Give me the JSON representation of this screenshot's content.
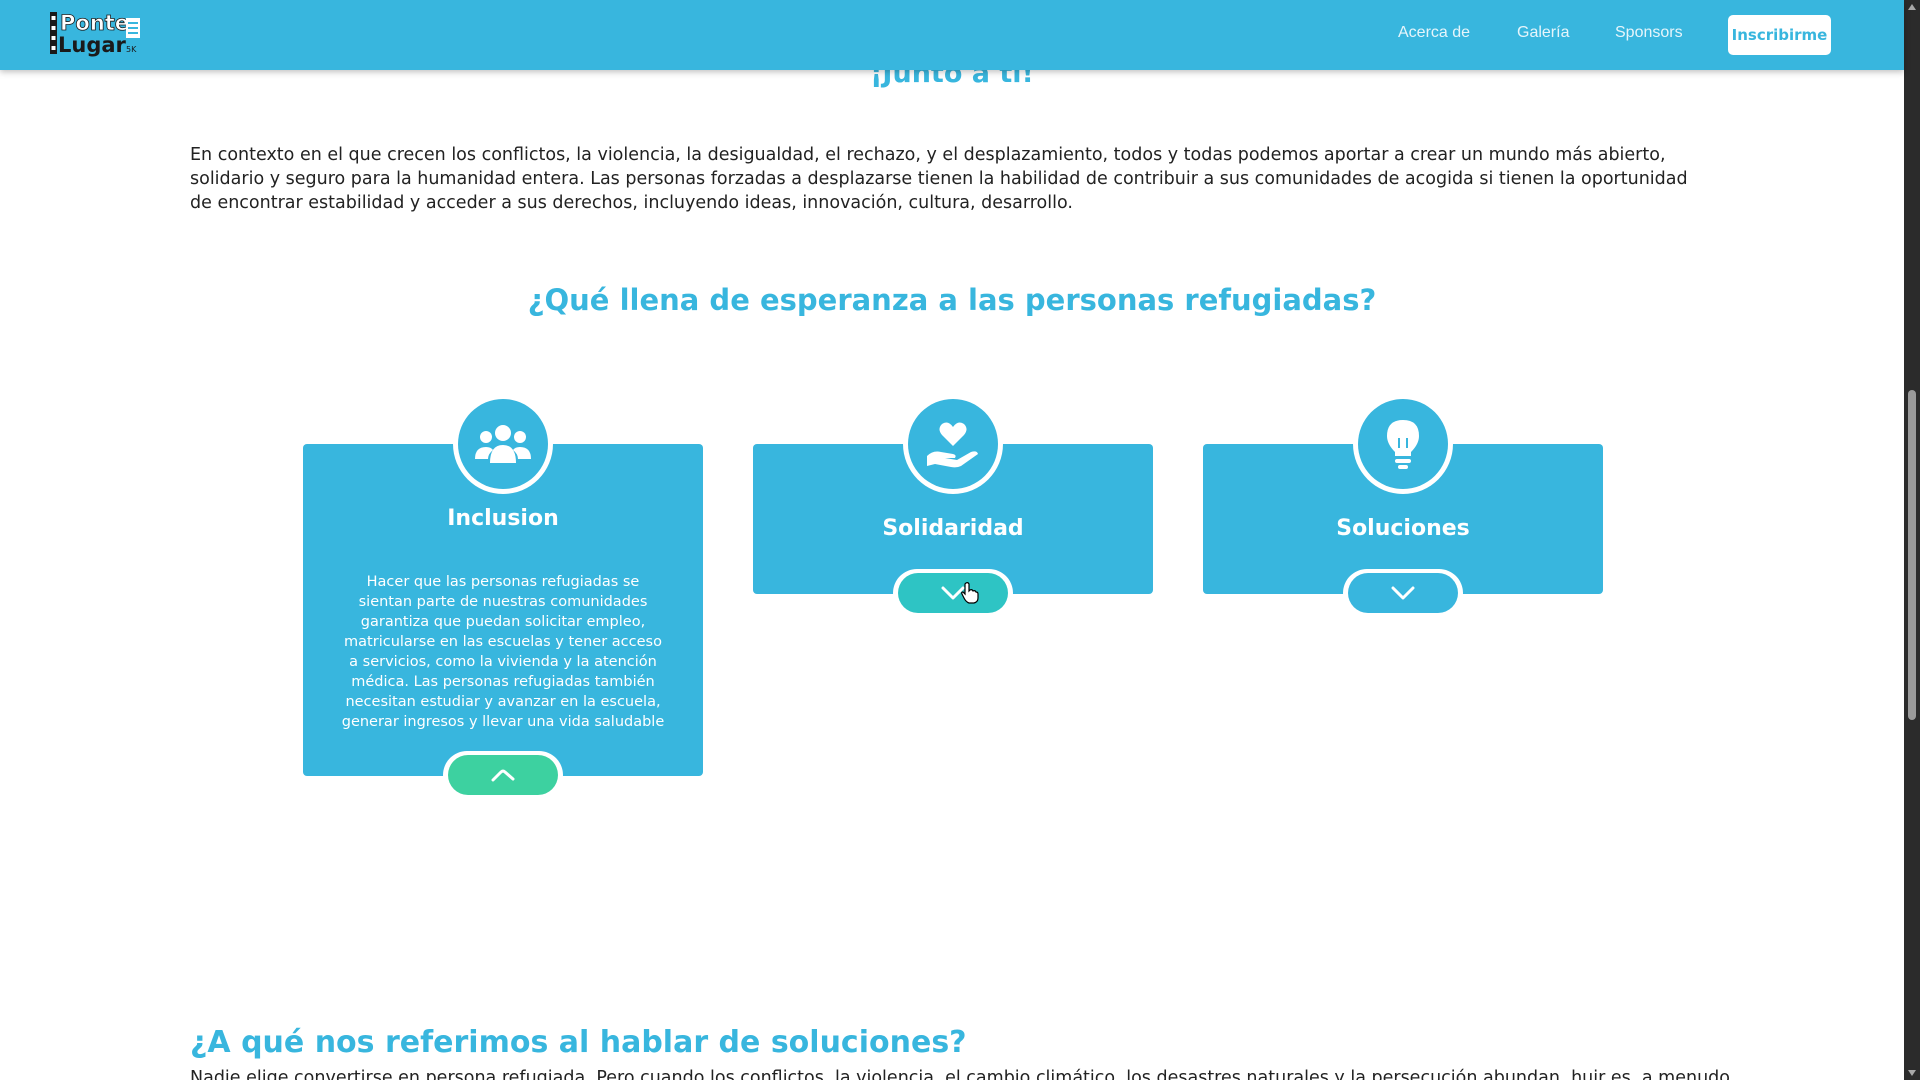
{
  "nav": {
    "logo_line1": "Ponte",
    "logo_line2": "Lugar",
    "logo_badge": "5K",
    "links": [
      "Acerca de",
      "Galería",
      "Sponsors"
    ],
    "cta": "Inscribirme"
  },
  "hero": {
    "title": "¡Junto a ti!",
    "intro": "En contexto en el que crecen los conflictos, la violencia, la desigualdad, el rechazo, y el desplazamiento, todos y todas podemos aportar a crear un mundo más abierto, solidario y seguro para la humanidad entera. Las personas forzadas a desplazarse tienen la habilidad de contribuir a sus comunidades de acogida si tienen la oportunidad de encontrar estabilidad y acceder a sus derechos, incluyendo ideas, innovación, cultura, desarrollo."
  },
  "hope": {
    "title": "¿Qué llena de esperanza a las personas refugiadas?",
    "cards": [
      {
        "title": "Inclusion",
        "icon": "people-group-icon",
        "expanded": true,
        "body": "Hacer que las personas refugiadas se sientan parte de nuestras comunidades garantiza que puedan solicitar empleo, matricularse en las escuelas y tener acceso a servicios, como la vivienda y la atención médica. Las personas refugiadas también necesitan estudiar y avanzar en la escuela, generar ingresos y llevar una vida saludable",
        "toggle_icon": "chevron-up-icon"
      },
      {
        "title": "Solidaridad",
        "icon": "hand-heart-icon",
        "expanded": false,
        "toggle_icon": "chevron-down-icon"
      },
      {
        "title": "Soluciones",
        "icon": "lightbulb-icon",
        "expanded": false,
        "toggle_icon": "chevron-down-icon"
      }
    ]
  },
  "solutions": {
    "title": "¿A qué nos referimos al hablar de soluciones?",
    "text": "Nadie elige convertirse en persona refugiada. Pero cuando los conflictos, la violencia, el cambio climático, los desastres naturales y la persecución abundan, huir es, a menudo"
  },
  "colors": {
    "primary": "#38b6de",
    "accent_green": "#3dd1a0",
    "hover_teal": "#2ec4c4"
  }
}
